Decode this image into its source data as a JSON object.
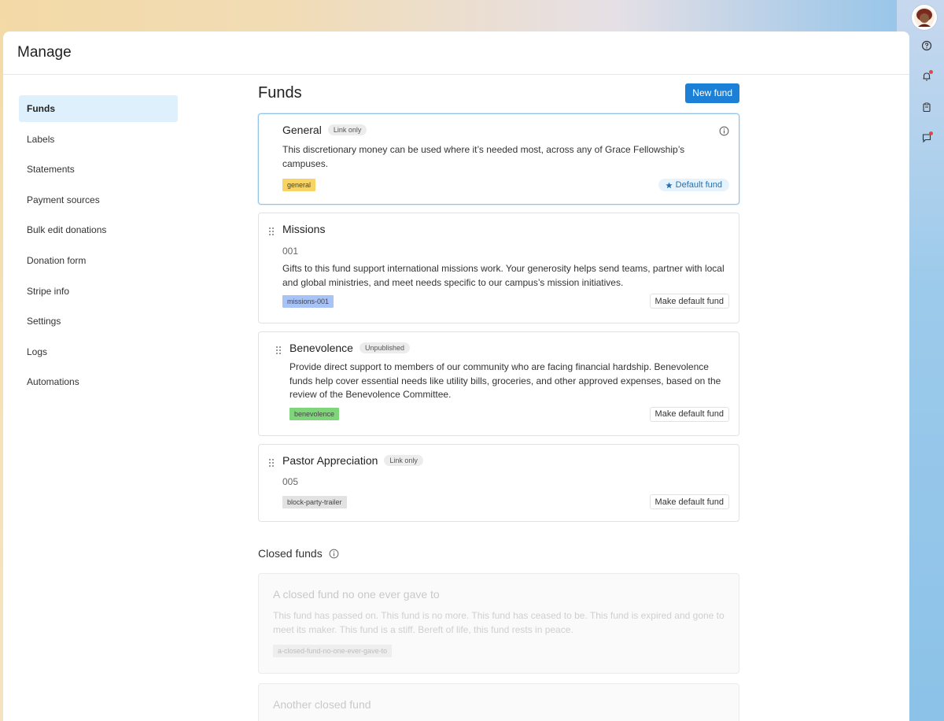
{
  "header": {
    "title": "Manage"
  },
  "sidebar": {
    "items": [
      {
        "label": "Funds",
        "active": true
      },
      {
        "label": "Labels"
      },
      {
        "label": "Statements"
      },
      {
        "label": "Payment sources"
      },
      {
        "label": "Bulk edit donations"
      },
      {
        "label": "Donation form"
      },
      {
        "label": "Stripe info"
      },
      {
        "label": "Settings"
      },
      {
        "label": "Logs"
      },
      {
        "label": "Automations"
      }
    ]
  },
  "main": {
    "title": "Funds",
    "new_fund_label": "New fund",
    "funds": [
      {
        "name": "General",
        "badge": "Link only",
        "description": "This discretionary money can be used where it’s needed most, across any of Grace Fellowship’s campuses.",
        "tag": "general",
        "tag_color": "#f7d463",
        "default_label": "Default fund"
      },
      {
        "name": "Missions",
        "code": "001",
        "description": "Gifts to this fund support international missions work. Your generosity helps send teams, partner with local and global ministries, and meet needs specific to our campus’s mission initiatives.",
        "tag": "missions-001",
        "tag_color": "#a8c4f7",
        "action_label": "Make default fund"
      },
      {
        "name": "Benevolence",
        "badge": "Unpublished",
        "description": "Provide direct support to members of our community who are facing financial hardship. Benevolence funds help cover essential needs like utility bills, groceries, and other approved expenses, based on the review of the Benevolence Committee.",
        "tag": "benevolence",
        "tag_color": "#7fd67a",
        "action_label": "Make default fund"
      },
      {
        "name": "Pastor Appreciation",
        "badge": "Link only",
        "code": "005",
        "tag": "block-party-trailer",
        "tag_color": "#e2e2e2",
        "action_label": "Make default fund"
      }
    ],
    "closed": {
      "title": "Closed funds",
      "funds": [
        {
          "name": "A closed fund no one ever gave to",
          "description": "This fund has passed on. This fund is no more. This fund has ceased to be. This fund is expired and gone to meet its maker. This fund is a stiff. Bereft of life, this fund rests in peace.",
          "tag": "a-closed-fund-no-one-ever-gave-to"
        },
        {
          "name": "Another closed fund"
        }
      ]
    }
  },
  "right_rail": {
    "icons": [
      "help-icon",
      "bell-icon",
      "clipboard-icon",
      "chat-icon"
    ]
  }
}
